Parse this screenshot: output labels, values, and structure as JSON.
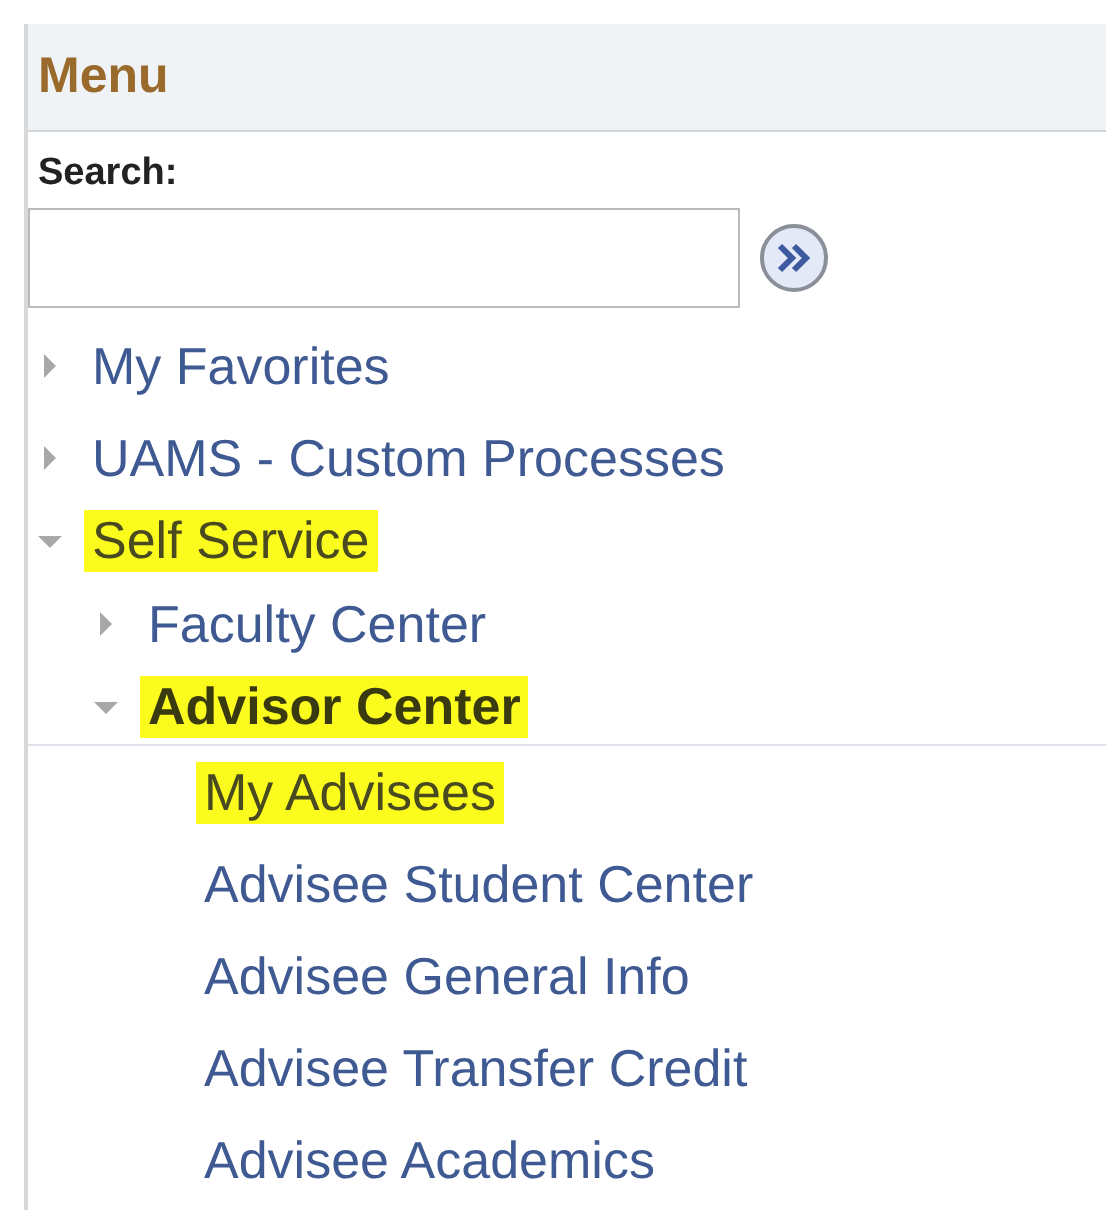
{
  "header": {
    "title": "Menu"
  },
  "search": {
    "label": "Search:"
  },
  "menu": [
    {
      "label": "My Favorites",
      "kind": "folder",
      "expanded": false,
      "highlighted": false,
      "current": false
    },
    {
      "label": "UAMS - Custom Processes",
      "kind": "folder",
      "expanded": false,
      "highlighted": false,
      "current": false
    },
    {
      "label": "Self Service",
      "kind": "folder",
      "expanded": true,
      "highlighted": true,
      "current": false,
      "children": [
        {
          "label": "Faculty Center",
          "kind": "folder",
          "expanded": false,
          "highlighted": false,
          "current": false
        },
        {
          "label": "Advisor Center",
          "kind": "folder",
          "expanded": true,
          "highlighted": true,
          "current": true,
          "children": [
            {
              "label": "My Advisees",
              "kind": "link",
              "highlighted": true,
              "current": false
            },
            {
              "label": "Advisee Student Center",
              "kind": "link",
              "highlighted": false,
              "current": false
            },
            {
              "label": "Advisee General Info",
              "kind": "link",
              "highlighted": false,
              "current": false
            },
            {
              "label": "Advisee Transfer Credit",
              "kind": "link",
              "highlighted": false,
              "current": false
            },
            {
              "label": "Advisee Academics",
              "kind": "link",
              "highlighted": false,
              "current": false
            }
          ]
        }
      ]
    }
  ]
}
